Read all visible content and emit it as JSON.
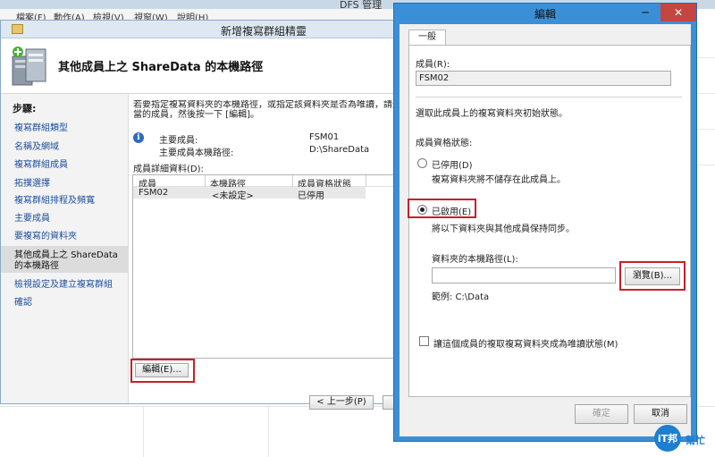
{
  "console": {
    "title": "DFS 管理",
    "menu": [
      "檔案(F)",
      "動作(A)",
      "檢視(V)",
      "視窗(W)",
      "說明(H)"
    ]
  },
  "wizard": {
    "title": "新增複寫群組精靈",
    "heading": "其他成員上之 ShareData 的本機路徑",
    "steps_header": "步驟:",
    "steps": [
      "複寫群組類型",
      "名稱及網域",
      "複寫群組成員",
      "拓撲選擇",
      "複寫群組排程及頻寬",
      "主要成員",
      "要複寫的資料夾",
      "其他成員上之 ShareData 的本機路徑",
      "檢視設定及建立複寫群組",
      "確認"
    ],
    "intro_line1": "若要指定複寫資料夾的本機路徑，或指定該資料夾是否為唯讀，請選取",
    "intro_line2": "當的成員，然後按一下 [編輯]。",
    "primary_member_label": "主要成員:",
    "primary_member_value": "FSM01",
    "primary_path_label": "主要成員本機路徑:",
    "primary_path_value": "D:\\ShareData",
    "details_label": "成員詳細資料(D):",
    "columns": [
      "成員",
      "本機路徑",
      "成員資格狀態"
    ],
    "rows": [
      {
        "member": "FSM02",
        "path": "<未設定>",
        "status": "已停用"
      }
    ],
    "edit_button": "編輯(E)...",
    "prev_button": "< 上一步(P)"
  },
  "dialog": {
    "title": "編輯",
    "minimize": "─",
    "close": "✕",
    "tab": "一般",
    "member_label": "成員(R):",
    "member_value": "FSM02",
    "desc": "選取此成員上的複寫資料夾初始狀態。",
    "status_label": "成員資格狀態:",
    "disabled_label": "已停用(D)",
    "disabled_desc": "複寫資料夾將不儲存在此成員上。",
    "enabled_label": "已啟用(E)",
    "enabled_desc": "將以下資料夾與其他成員保持同步。",
    "local_path_label": "資料夾的本機路徑(L):",
    "local_path_value": "",
    "browse_button": "瀏覽(B)...",
    "example": "範例: C:\\Data",
    "readonly_label": "讓這個成員的複取複寫資料夾成為唯讀狀態(M)",
    "ok_button": "確定",
    "cancel_button": "取消",
    "disabled_selected": false,
    "enabled_selected": true,
    "readonly_checked": false
  },
  "watermark": {
    "text1": "iT邦",
    "text2": "幫忙"
  },
  "colors": {
    "highlight": "#c8202a",
    "dialog_frame": "#3b8fd6",
    "link": "#1b4d9c"
  }
}
